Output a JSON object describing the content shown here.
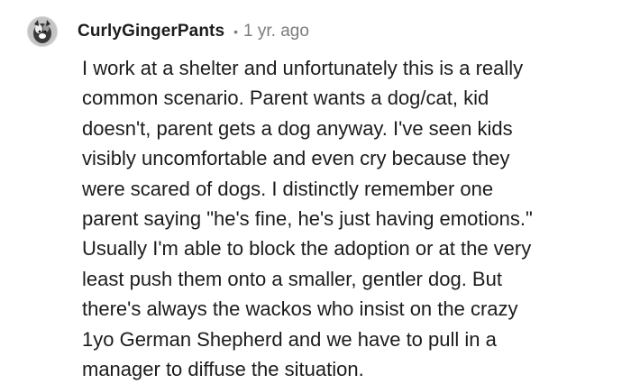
{
  "comment": {
    "author": "CurlyGingerPants",
    "separator": "•",
    "timestamp": "1 yr. ago",
    "body_lines": [
      "I work at a shelter and unfortunately this is a really",
      "common scenario. Parent wants a dog/cat, kid",
      "doesn't, parent gets a dog anyway. I've seen kids",
      "visibly uncomfortable and even cry because they",
      "were scared of dogs. I distinctly remember one",
      "parent saying \"he's fine, he's just having emotions.\"",
      "Usually I'm able to block the adoption or at the very",
      "least push them onto a smaller, gentler dog. But",
      "there's always the wackos who insist on the crazy",
      "1yo German Shepherd and we have to pull in a",
      "manager to diffuse the situation."
    ]
  }
}
